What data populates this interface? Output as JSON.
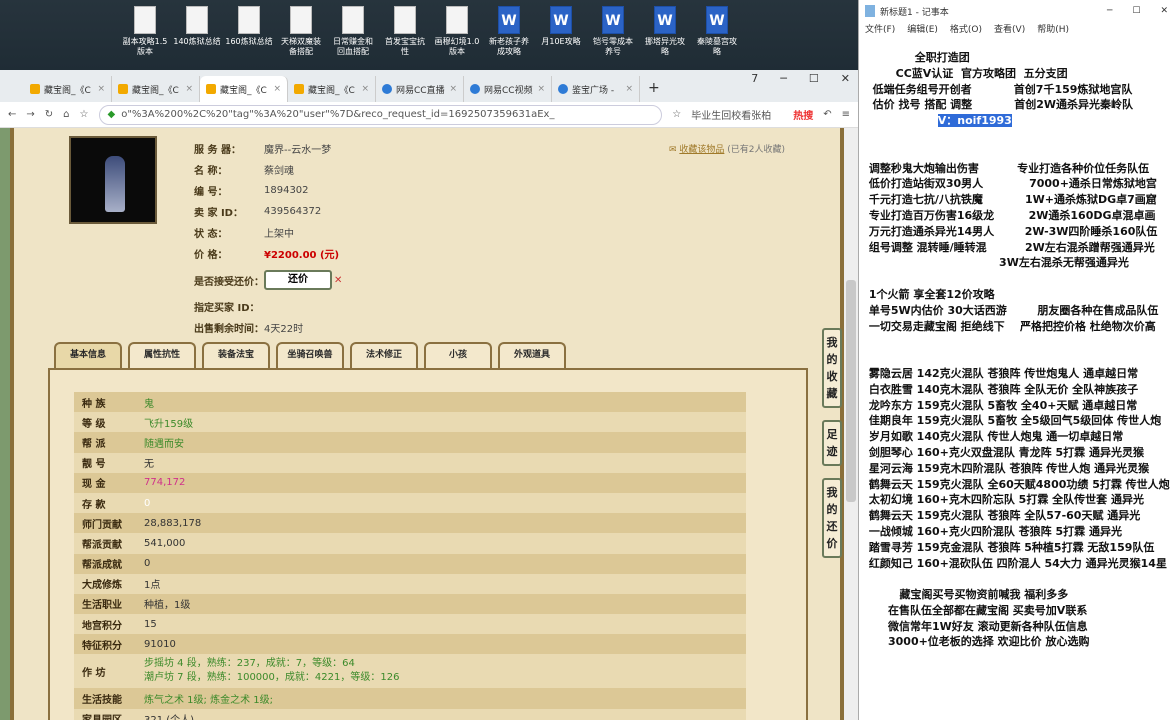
{
  "desktop": {
    "icons": [
      {
        "label": "副本攻略1.5\n版本",
        "type": "doc"
      },
      {
        "label": "140炼狱总结",
        "type": "doc"
      },
      {
        "label": "160炼狱总结",
        "type": "doc"
      },
      {
        "label": "天梯双魔装\n备搭配",
        "type": "doc"
      },
      {
        "label": "日常赚金和\n回血搭配",
        "type": "doc"
      },
      {
        "label": "首发宝宝抗\n性",
        "type": "doc"
      },
      {
        "label": "画穆幻境1.0\n版本",
        "type": "doc"
      },
      {
        "label": "新老孩子养\n成攻略",
        "type": "word"
      },
      {
        "label": "月10E攻略",
        "type": "word"
      },
      {
        "label": "铠号零成本\n养号",
        "type": "word"
      },
      {
        "label": "挪塔异光攻\n略",
        "type": "word"
      },
      {
        "label": "秦陵墓宫攻\n略",
        "type": "word"
      }
    ]
  },
  "browser": {
    "tabs": [
      {
        "label": "藏宝阁_《C",
        "active": false,
        "fav": "orange"
      },
      {
        "label": "藏宝阁_《C",
        "active": false,
        "fav": "orange"
      },
      {
        "label": "藏宝阁_《C",
        "active": true,
        "fav": "orange"
      },
      {
        "label": "藏宝阁_《C",
        "active": false,
        "fav": "orange"
      },
      {
        "label": "网易CC直播",
        "active": false,
        "fav": "blue"
      },
      {
        "label": "网易CC视频",
        "active": false,
        "fav": "blue"
      },
      {
        "label": "鉴宝广场 -",
        "active": false,
        "fav": "blue"
      }
    ],
    "tab_count": "7",
    "url": "o\"%3A%200%2C%20\"tag\"%3A%20\"user\"%7D&reco_request_id=1692507359631aEx_",
    "search_hint": "毕业生回校看张柏",
    "hot_label": "热搜"
  },
  "listing": {
    "rows": [
      {
        "label": "服 务 器：",
        "value": "魔界--云水一梦"
      },
      {
        "label": "名       称：",
        "value": "蔡剑魂"
      },
      {
        "label": "编       号：",
        "value": "1894302"
      },
      {
        "label": "卖  家  ID：",
        "value": "439564372"
      },
      {
        "label": "状       态：",
        "value": "上架中"
      },
      {
        "label": "价       格：",
        "value": "¥2200.00 (元)"
      },
      {
        "label": "是否接受还价：",
        "value": ""
      },
      {
        "label": "指定买家 ID：",
        "value": ""
      },
      {
        "label": "出售剩余时间：",
        "value": "4天22时"
      }
    ],
    "counter_offer_button": "还价",
    "favorite_link": "收藏该物品",
    "favorite_count": "(已有2人收藏)"
  },
  "side_buttons": [
    {
      "label": "我的收藏"
    },
    {
      "label": "足迹"
    },
    {
      "label": "我的还价"
    }
  ],
  "game_tabs": [
    {
      "label": "基本信息",
      "active": true
    },
    {
      "label": "属性抗性",
      "active": false
    },
    {
      "label": "装备法宝",
      "active": false
    },
    {
      "label": "坐骑召唤兽",
      "active": false
    },
    {
      "label": "法术修正",
      "active": false
    },
    {
      "label": "小孩",
      "active": false
    },
    {
      "label": "外观道具",
      "active": false
    }
  ],
  "stats": [
    {
      "k": "种    族",
      "v": "鬼",
      "style": "green"
    },
    {
      "k": "等    级",
      "v": "飞升159级",
      "style": "green"
    },
    {
      "k": "帮    派",
      "v": "随遇而安",
      "style": "green"
    },
    {
      "k": "靓    号",
      "v": "无",
      "style": ""
    },
    {
      "k": "现    金",
      "v": "774,172",
      "style": "pink"
    },
    {
      "k": "存    款",
      "v": "0",
      "style": "white"
    },
    {
      "k": "师门贡献",
      "v": "28,883,178",
      "style": ""
    },
    {
      "k": "帮派贡献",
      "v": "541,000",
      "style": ""
    },
    {
      "k": "帮派成就",
      "v": "0",
      "style": ""
    },
    {
      "k": "大成修炼",
      "v": "1点",
      "style": ""
    },
    {
      "k": "生活职业",
      "v": "种植，1级",
      "style": ""
    },
    {
      "k": "地宫积分",
      "v": "15",
      "style": ""
    },
    {
      "k": "特征积分",
      "v": "91010",
      "style": ""
    },
    {
      "k": "作    坊",
      "v": "步摇坊 4 段，熟练：237，成就：7，等级：64\n潮卢坊 7 段，熟练：100000，成就：4221，等级：126",
      "style": "green ml"
    },
    {
      "k": "生活技能",
      "v": "炼气之术 1级; 炼金之术 1级;",
      "style": "green"
    },
    {
      "k": "家具园区",
      "v": "321 (个人)",
      "style": ""
    }
  ],
  "notepad": {
    "title": "新标题1 - 记事本",
    "menu": [
      "文件(F)",
      "编辑(E)",
      "格式(O)",
      "查看(V)",
      "帮助(H)"
    ],
    "lines_top": "             全职打造团\n        CC蓝V认证  官方攻略团  五分支团\n  低端任务组号开创者           首创7千159炼狱地宫队\n  估价 找号 搭配 调整           首创2W通杀异光秦岭队",
    "highlight": "V：noif1993",
    "lines_bottom": "\n\n 调整秒鬼大炮输出伤害          专业打造各种价位任务队伍\n 低价打造站街双30男人            7000+通杀日常炼狱地宫\n 千元打造七抗/八抗铁魔           1W+通杀炼狱DG卓7画窟\n 专业打造百万伤害16级龙         2W通杀160DG卓混卓画\n 万元打造通杀异光14男人        2W-3W四阶睡杀160队伍\n 组号调整 混转睡/睡转混          2W左右混杀蹭帮强通异光\n                                   3W左右混杀无帮强通异光\n\n 1个火箭 享全套12价攻略\n 单号5W内估价 30大话西游        朋友圈各种在售成品队伍\n 一切交易走藏宝阁 拒绝线下    严格把控价格 杜绝物次价高\n\n\n 雾隐云居 142克火混队 苍狼阵 传世炮鬼人 通卓越日常\n 白衣胜雪 140克木混队 苍狼阵 全队无价 全队神族孩子\n 龙吟东方 159克火混队 5畜牧 全40+天赋 通卓越日常\n 佳期良年 159克火混队 5畜牧 全5级回气5级回体 传世人炮\n 岁月如歌 140克火混队 传世人炮鬼 通一切卓越日常\n 剑胆琴心 160+克火双盘混队 青龙阵 5打霖 通异光灵猴\n 星河云海 159克木四阶混队 苍狼阵 传世人炮 通异光灵猴\n 鹤舞云天 159克火混队 全60天赋4800功绩 5打霖 传世人炮\n 太初幻境 160+克木四阶忘队 5打霖 全队传世套 通异光\n 鹤舞云天 159克火混队 苍狼阵 全队57-60天赋 通异光\n 一战倾城 160+克火四阶混队 苍狼阵 5打霖 通异光\n 踏雪寻芳 159克金混队 苍狼阵 5种植5打霖 无敌159队伍\n 红颜知己 160+混砍队伍 四阶混人 54大力 通异光灵猴14星\n\n         藏宝阁买号买物资前喊我 福利多多\n      在售队伍全部都在藏宝阁 买卖号加V联系\n      微信常年1W好友 滚动更新各种队伍信息\n      3000+位老板的选择 欢迎比价 放心选购"
  },
  "colors": {
    "accent_blue": "#2f6bd8",
    "price_red": "#cc0000",
    "frame_brown": "#8a6f3a"
  }
}
